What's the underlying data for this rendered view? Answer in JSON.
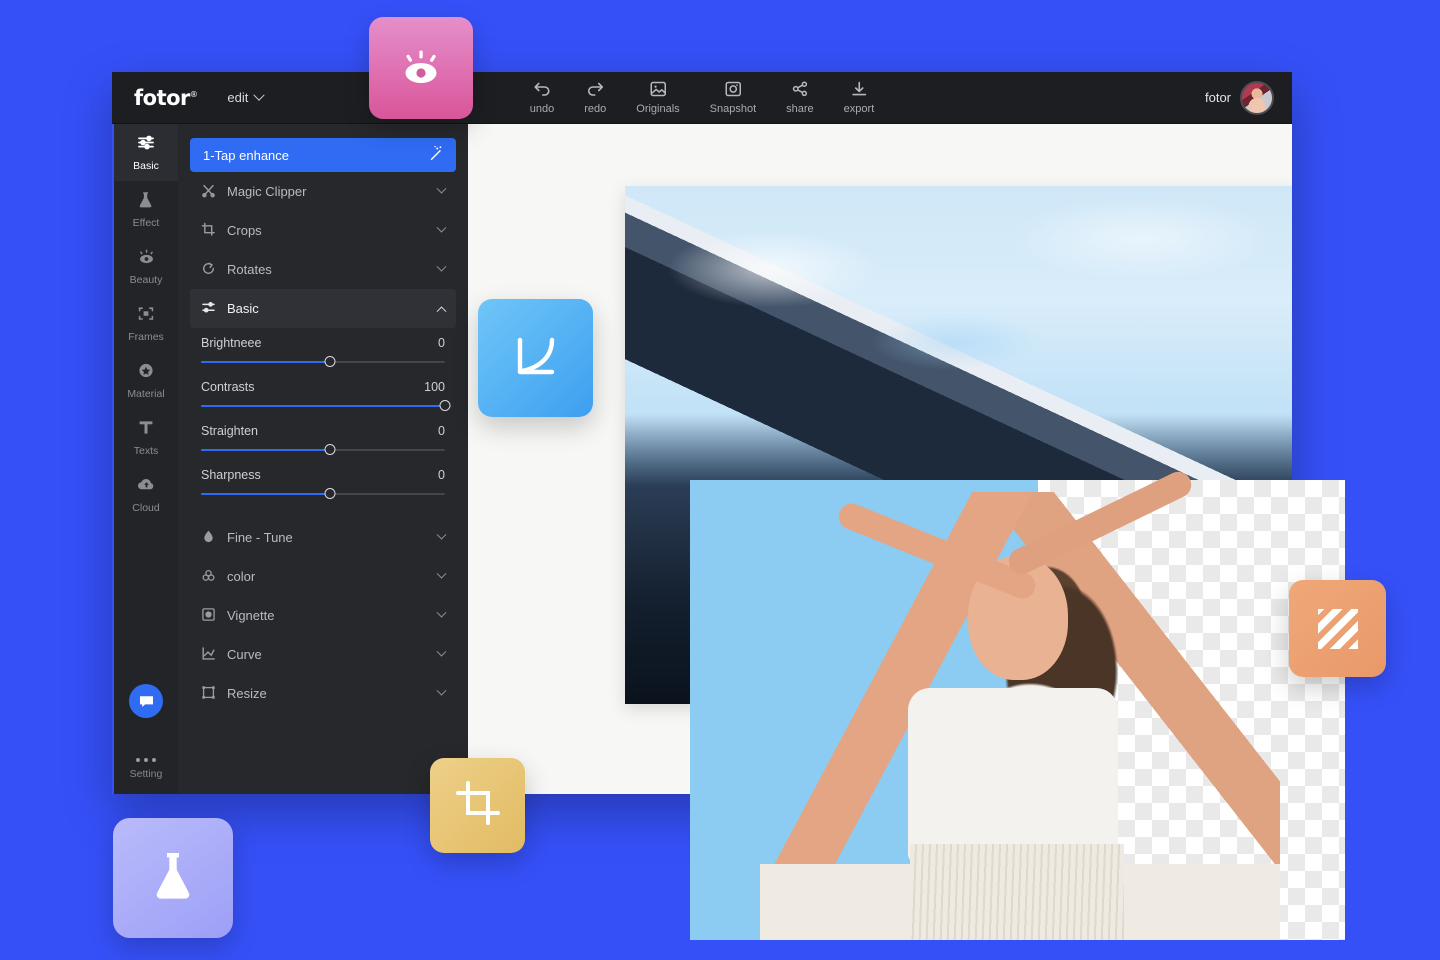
{
  "app": {
    "brand": "fotor",
    "brand_mark": "®",
    "menu_label": "edit"
  },
  "toolbar": {
    "items": [
      {
        "label": "undo",
        "icon": "undo-icon"
      },
      {
        "label": "redo",
        "icon": "redo-icon"
      },
      {
        "label": "Originals",
        "icon": "image-icon"
      },
      {
        "label": "Snapshot",
        "icon": "camera-icon"
      },
      {
        "label": "share",
        "icon": "share-icon"
      },
      {
        "label": "export",
        "icon": "download-icon"
      }
    ]
  },
  "user": {
    "name": "fotor"
  },
  "rail": {
    "items": [
      {
        "label": "Basic",
        "icon": "sliders-icon",
        "active": true
      },
      {
        "label": "Effect",
        "icon": "flask-icon",
        "active": false
      },
      {
        "label": "Beauty",
        "icon": "eye-icon",
        "active": false
      },
      {
        "label": "Frames",
        "icon": "frame-icon",
        "active": false
      },
      {
        "label": "Material",
        "icon": "sticker-icon",
        "active": false
      },
      {
        "label": "Texts",
        "icon": "text-icon",
        "active": false
      },
      {
        "label": "Cloud",
        "icon": "cloud-icon",
        "active": false
      }
    ],
    "chat_icon": "chat-bubble-icon",
    "setting_label": "Setting",
    "setting_icon": "more-dots-icon"
  },
  "panel": {
    "enhance_label": "1-Tap enhance",
    "enhance_icon": "magic-wand-icon",
    "rows_top": [
      {
        "label": "Magic Clipper",
        "icon": "scissors-icon",
        "state": "collapsed"
      },
      {
        "label": "Crops",
        "icon": "crop-icon",
        "state": "collapsed"
      },
      {
        "label": "Rotates",
        "icon": "rotate-icon",
        "state": "collapsed"
      },
      {
        "label": "Basic",
        "icon": "sliders-icon",
        "state": "expanded"
      }
    ],
    "sliders": [
      {
        "label": "Brightneee",
        "value": "0",
        "percent": 53
      },
      {
        "label": "Contrasts",
        "value": "100",
        "percent": 100
      },
      {
        "label": "Straighten",
        "value": "0",
        "percent": 53
      },
      {
        "label": "Sharpness",
        "value": "0",
        "percent": 53
      }
    ],
    "rows_bottom": [
      {
        "label": "Fine - Tune",
        "icon": "droplet-icon",
        "state": "collapsed"
      },
      {
        "label": "color",
        "icon": "color-icon",
        "state": "collapsed"
      },
      {
        "label": "Vignette",
        "icon": "vignette-icon",
        "state": "collapsed"
      },
      {
        "label": "Curve",
        "icon": "curve-icon",
        "state": "collapsed"
      },
      {
        "label": "Resize",
        "icon": "resize-icon",
        "state": "collapsed"
      }
    ]
  },
  "floating_cards": [
    {
      "name": "beauty-card",
      "icon": "eye-icon",
      "color": "#d9559a"
    },
    {
      "name": "curve-card",
      "icon": "curve-arrow-icon",
      "color": "#3d9ff0"
    },
    {
      "name": "crop-card",
      "icon": "crop-icon",
      "color": "#e2bb63"
    },
    {
      "name": "texture-card",
      "icon": "stripes-icon",
      "color": "#e8996a"
    },
    {
      "name": "effect-card",
      "icon": "flask-icon",
      "color": "#9d9ff7"
    }
  ],
  "theme": {
    "background": "#3550f7",
    "window_bg": "#1f2023",
    "panel_bg": "#27282c",
    "accent": "#2f6bf3",
    "canvas_bg": "#f7f7f5",
    "cutout_panel": "#8ccbf2"
  }
}
